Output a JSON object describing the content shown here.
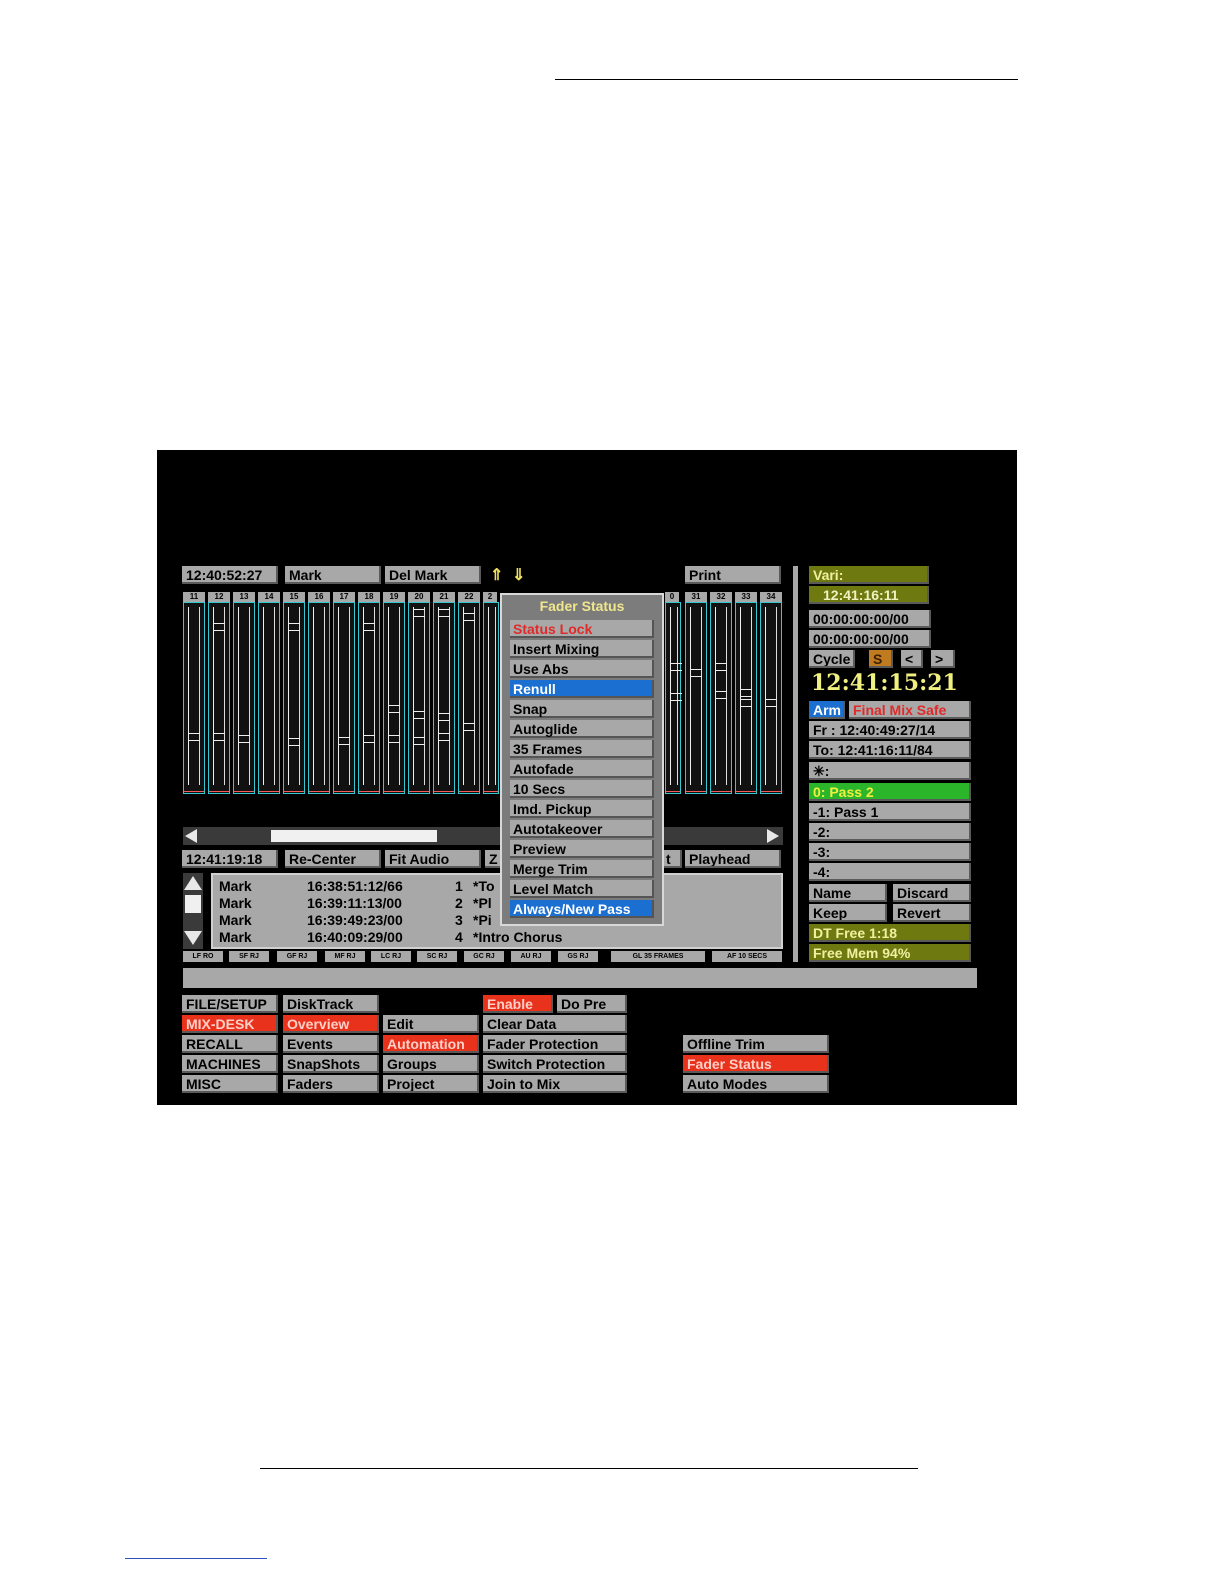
{
  "toolbar": {
    "timecode": "12:40:52:27",
    "mark": "Mark",
    "del_mark": "Del Mark",
    "up_arrow": "⇑",
    "down_arrow": "⇓",
    "print": "Print"
  },
  "channels_left": [
    "11",
    "12",
    "13",
    "14",
    "15",
    "16",
    "17",
    "18",
    "19",
    "20",
    "21",
    "22",
    "2"
  ],
  "channels_right": [
    "0",
    "31",
    "32",
    "33",
    "34"
  ],
  "bottom_bar": {
    "timecode": "12:41:19:18",
    "recenter": "Re-Center",
    "fit_audio": "Fit Audio",
    "z_partial": "Z",
    "t_partial": "t",
    "playhead": "Playhead"
  },
  "events": [
    {
      "type": "Mark",
      "time": "16:38:51:12/66",
      "num": "1",
      "name": "*To"
    },
    {
      "type": "Mark",
      "time": "16:39:11:13/00",
      "num": "2",
      "name": "*Pl"
    },
    {
      "type": "Mark",
      "time": "16:39:49:23/00",
      "num": "3",
      "name": "*Pi"
    },
    {
      "type": "Mark",
      "time": "16:40:09:29/00",
      "num": "4",
      "name": "*Intro Chorus"
    }
  ],
  "tags": [
    "LF RO",
    "SF RJ",
    "GF RJ",
    "MF RJ",
    "LC RJ",
    "SC RJ",
    "GC RJ",
    "AU RJ",
    "GS RJ",
    "GL 35 FRAMES",
    "AF 10 SECS"
  ],
  "popup": {
    "title": "Fader Status",
    "items": [
      "Status Lock",
      "Insert Mixing",
      "Use Abs",
      "Renull",
      "Snap",
      "Autoglide",
      "35 Frames",
      "Autofade",
      "10 Secs",
      "Imd. Pickup",
      "Autotakeover",
      "Preview",
      "Merge Trim",
      "Level Match",
      "Always/New Pass"
    ]
  },
  "right_panel": {
    "vari": "Vari:",
    "vari_time": "12:41:16:11",
    "tc_a": "00:00:00:00/00",
    "tc_b": "00:00:00:00/00",
    "cycle": "Cycle",
    "s": "S",
    "prev": "<",
    "next": ">",
    "big_time": "12:41:15:21",
    "arm": "Arm",
    "final_mix_safe": "Final Mix Safe",
    "from": "Fr : 12:40:49:27/14",
    "to": "To: 12:41:16:11/84",
    "star": "✳:",
    "pass0": "0: Pass 2",
    "pass1": "-1: Pass 1",
    "pass2": "-2:",
    "pass3": "-3:",
    "pass4": "-4:",
    "name": "Name",
    "discard": "Discard",
    "keep": "Keep",
    "revert": "Revert",
    "dt_free": "DT Free 1:18",
    "free_mem": "Free Mem 94%"
  },
  "menu": {
    "col1": [
      "FILE/SETUP",
      "MIX-DESK",
      "RECALL",
      "MACHINES",
      "MISC"
    ],
    "col2": [
      "DiskTrack",
      "Overview",
      "Events",
      "SnapShots",
      "Faders"
    ],
    "col3": [
      "Edit",
      "Automation",
      "Groups",
      "Project"
    ],
    "col4": [
      "Enable",
      "Clear Data",
      "Fader Protection",
      "Switch Protection",
      "Join to Mix"
    ],
    "do_pre": "Do Pre",
    "col5": [
      "Offline Trim",
      "Fader Status",
      "Auto Modes"
    ]
  },
  "colors": {
    "accent_red": "#e8321c",
    "accent_blue": "#1a6fd0",
    "cyan": "#36c8d0"
  }
}
